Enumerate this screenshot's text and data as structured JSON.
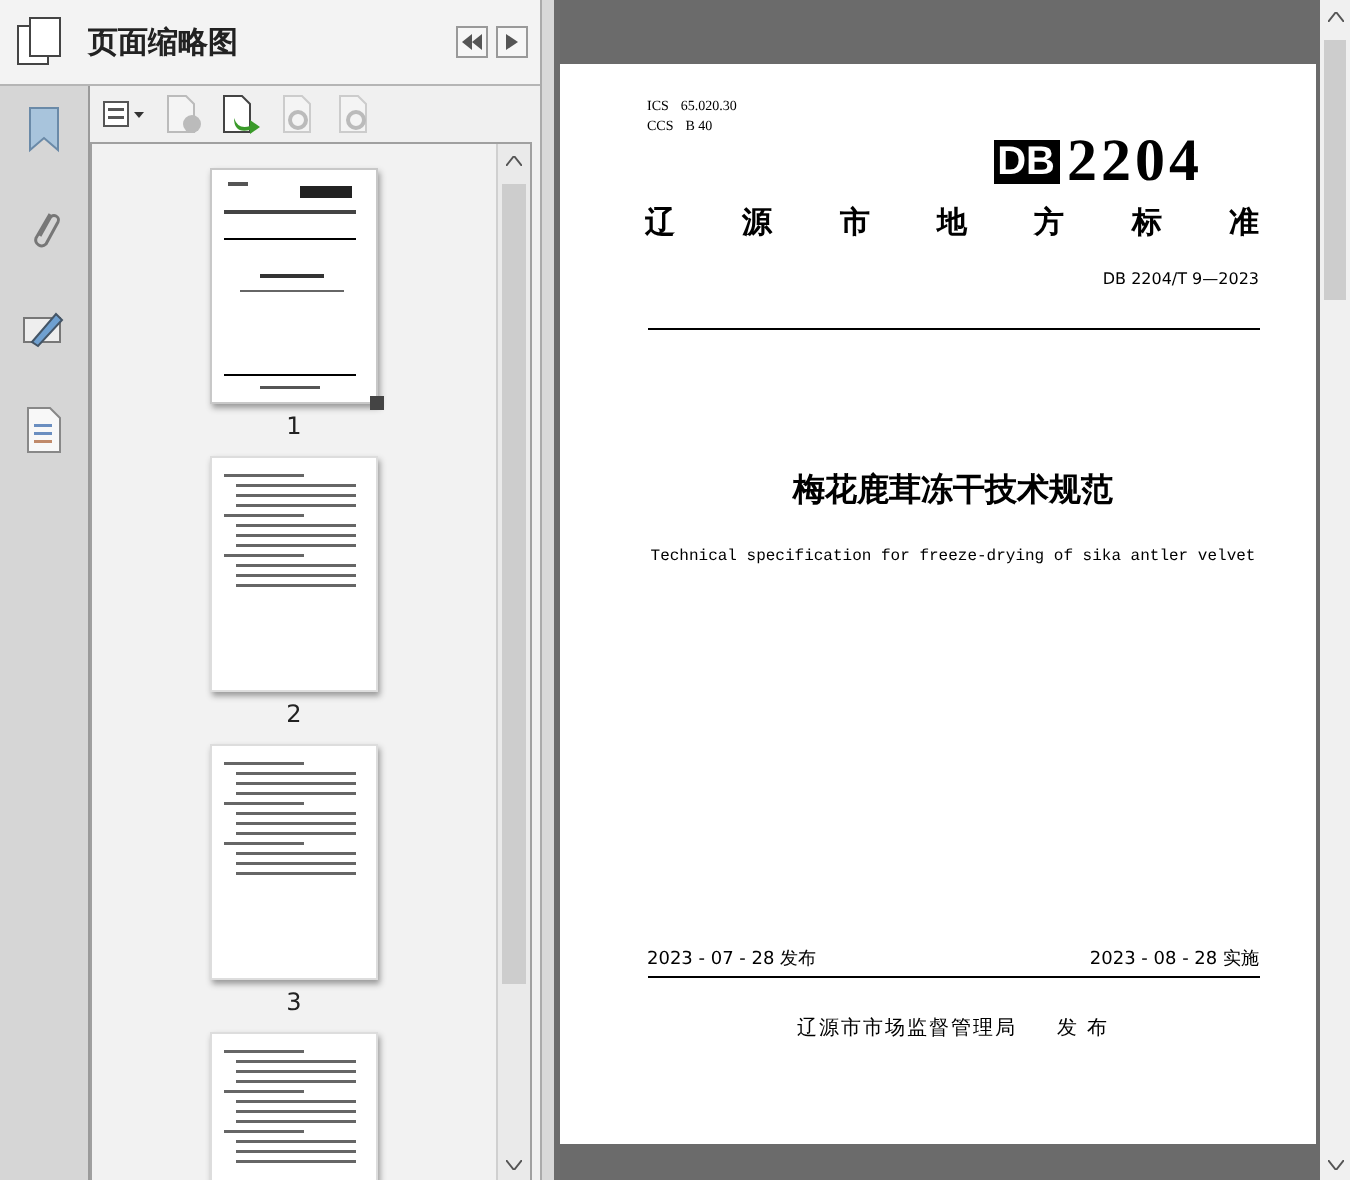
{
  "panel": {
    "title": "页面缩略图"
  },
  "thumbnails": [
    {
      "label": "1",
      "selected": true
    },
    {
      "label": "2",
      "selected": false
    },
    {
      "label": "3",
      "selected": false
    },
    {
      "selected": false
    }
  ],
  "document": {
    "ics_label": "ICS",
    "ics": "65.020.30",
    "ccs_label": "CCS",
    "ccs": "B 40",
    "logo_prefix": "DB",
    "logo_number": "2204",
    "category": "辽源市地方标准",
    "standard_number": "DB 2204/T 9—2023",
    "title": "梅花鹿茸冻干技术规范",
    "english_title": "Technical specification for freeze-drying of sika antler velvet",
    "issue_date": "2023 - 07 - 28 发布",
    "implement_date": "2023 - 08 - 28 实施",
    "publisher": "辽源市市场监督管理局",
    "publish_word": "发 布"
  }
}
